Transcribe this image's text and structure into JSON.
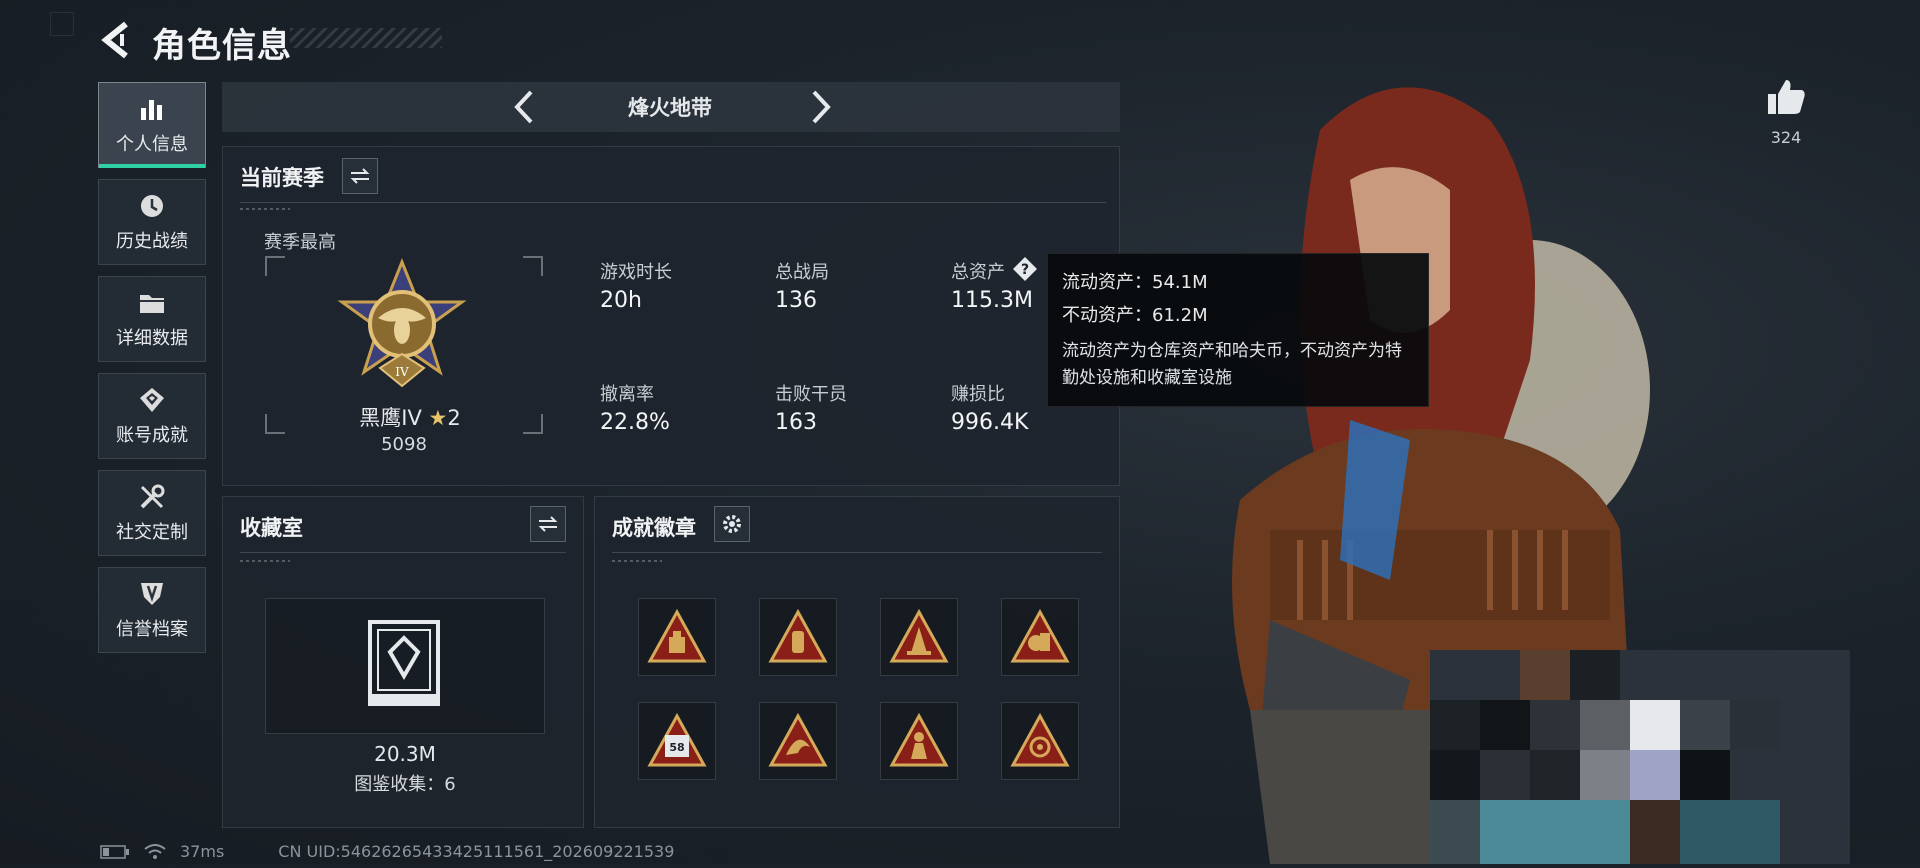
{
  "header": {
    "title": "角色信息"
  },
  "nav": {
    "items": [
      {
        "label": "个人信息",
        "icon": "bar-chart-icon",
        "active": true
      },
      {
        "label": "历史战绩",
        "icon": "history-icon"
      },
      {
        "label": "详细数据",
        "icon": "folder-icon"
      },
      {
        "label": "账号成就",
        "icon": "achievement-icon"
      },
      {
        "label": "社交定制",
        "icon": "tools-icon"
      },
      {
        "label": "信誉档案",
        "icon": "shield-icon"
      }
    ]
  },
  "mode": {
    "title": "烽火地带"
  },
  "season": {
    "title": "当前赛季",
    "highest_label": "赛季最高",
    "rank_name": "黑鹰IV",
    "rank_stars": "2",
    "rank_score": "5098",
    "stats": [
      {
        "label": "游戏时长",
        "value": "20h"
      },
      {
        "label": "总战局",
        "value": "136"
      },
      {
        "label": "总资产",
        "value": "115.3M"
      },
      {
        "label": "撤离率",
        "value": "22.8%"
      },
      {
        "label": "击败干员",
        "value": "163"
      },
      {
        "label": "赚损比",
        "value": "996.4K"
      }
    ]
  },
  "tooltip": {
    "line1": "流动资产：54.1M",
    "line2": "不动资产：61.2M",
    "desc": "流动资产为仓库资产和哈夫币，不动资产为特勤处设施和收藏室设施"
  },
  "collection": {
    "title": "收藏室",
    "value": "20.3M",
    "catalog": "图鉴收集：6"
  },
  "badges": {
    "title": "成就徽章",
    "items": [
      "badge-1",
      "badge-2",
      "badge-3",
      "badge-4",
      "badge-5",
      "badge-6",
      "badge-7",
      "badge-8"
    ],
    "badge5_text": "58"
  },
  "likes": {
    "count": "324"
  },
  "status": {
    "ping": "37ms",
    "uid": "CN UID:546262654334251115​61_202609221539"
  },
  "colors": {
    "accent": "#2fd0a4",
    "gold": "#d4aa5a",
    "badge_red": "#8a1f18"
  }
}
